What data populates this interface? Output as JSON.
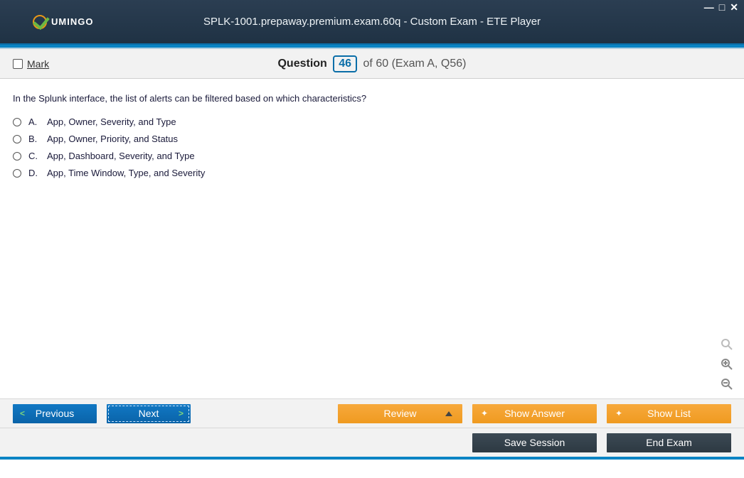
{
  "window": {
    "title": "SPLK-1001.prepaway.premium.exam.60q - Custom Exam - ETE Player",
    "logo_text": "UMINGO"
  },
  "header": {
    "mark_label": "Mark",
    "question_word": "Question",
    "current_number": "46",
    "of_word": "of",
    "total": "60",
    "exam_ref": "(Exam A, Q56)"
  },
  "question": {
    "text": "In the Splunk interface, the list of alerts can be filtered based on which characteristics?",
    "options": [
      {
        "letter": "A.",
        "text": "App, Owner, Severity, and Type"
      },
      {
        "letter": "B.",
        "text": "App, Owner, Priority, and Status"
      },
      {
        "letter": "C.",
        "text": "App, Dashboard, Severity, and Type"
      },
      {
        "letter": "D.",
        "text": "App, Time Window, Type, and Severity"
      }
    ]
  },
  "buttons": {
    "previous": "Previous",
    "next": "Next",
    "review": "Review",
    "show_answer": "Show Answer",
    "show_list": "Show List",
    "save_session": "Save Session",
    "end_exam": "End Exam"
  }
}
